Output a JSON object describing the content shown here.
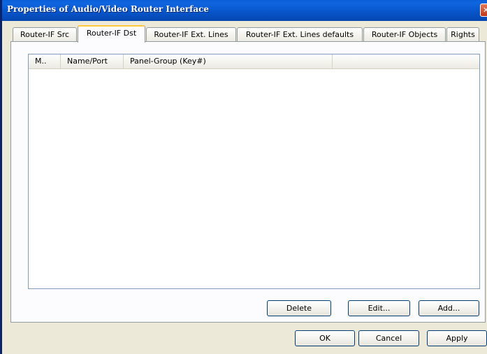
{
  "window": {
    "title": "Properties of Audio/Video Router Interface",
    "close_glyph": "✕"
  },
  "tabs": [
    {
      "label": "Router-IF Src",
      "selected": false
    },
    {
      "label": "Router-IF Dst",
      "selected": true
    },
    {
      "label": "Router-IF Ext. Lines",
      "selected": false
    },
    {
      "label": "Router-IF Ext. Lines defaults",
      "selected": false
    },
    {
      "label": "Router-IF Objects",
      "selected": false
    },
    {
      "label": "Rights",
      "selected": false
    }
  ],
  "list": {
    "columns": [
      "M..",
      "Name/Port",
      "Panel-Group (Key#)"
    ],
    "rows": []
  },
  "panel_buttons": {
    "delete": "Delete",
    "edit": "Edit...",
    "add": "Add..."
  },
  "dialog_buttons": {
    "ok": "OK",
    "cancel": "Cancel",
    "apply": "Apply"
  },
  "colors": {
    "titlebar": "#0754c8",
    "dialog_bg": "#ece9d8",
    "selected_tab_accent": "#ffc73c"
  }
}
